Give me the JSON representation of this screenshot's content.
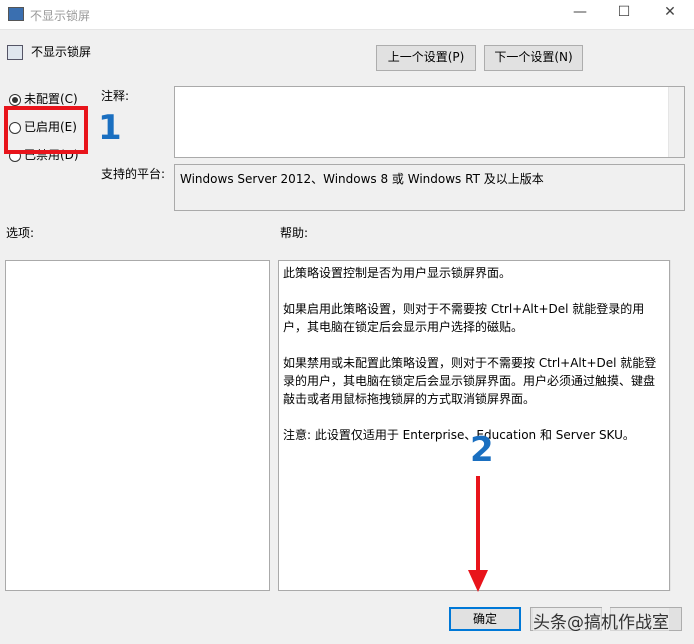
{
  "window": {
    "title": "不显示锁屏"
  },
  "header": {
    "policy_title": "不显示锁屏",
    "prev_button": "上一个设置(P)",
    "next_button": "下一个设置(N)"
  },
  "options": [
    {
      "label": "未配置(C)",
      "checked": true
    },
    {
      "label": "已启用(E)",
      "checked": false
    },
    {
      "label": "已禁用(D)",
      "checked": false
    }
  ],
  "comment_label": "注释:",
  "platform_label": "支持的平台:",
  "platform_value": "Windows Server 2012、Windows 8 或 Windows RT 及以上版本",
  "options_label": "选项:",
  "help_label": "帮助:",
  "help_paragraphs": [
    "此策略设置控制是否为用户显示锁屏界面。",
    "如果启用此策略设置，则对于不需要按 Ctrl+Alt+Del 就能登录的用户，其电脑在锁定后会显示用户选择的磁贴。",
    "如果禁用或未配置此策略设置，则对于不需要按 Ctrl+Alt+Del 就能登录的用户，其电脑在锁定后会显示锁屏界面。用户必须通过触摸、键盘敲击或者用鼠标拖拽锁屏的方式取消锁屏界面。",
    "注意: 此设置仅适用于 Enterprise、Education 和 Server SKU。"
  ],
  "footer": {
    "ok_button": "确定"
  },
  "annotations": {
    "step1": "1",
    "step2": "2",
    "highlight_color": "#e8141b",
    "number_color": "#1a6fc0"
  },
  "watermark": "头条@搞机作战室"
}
